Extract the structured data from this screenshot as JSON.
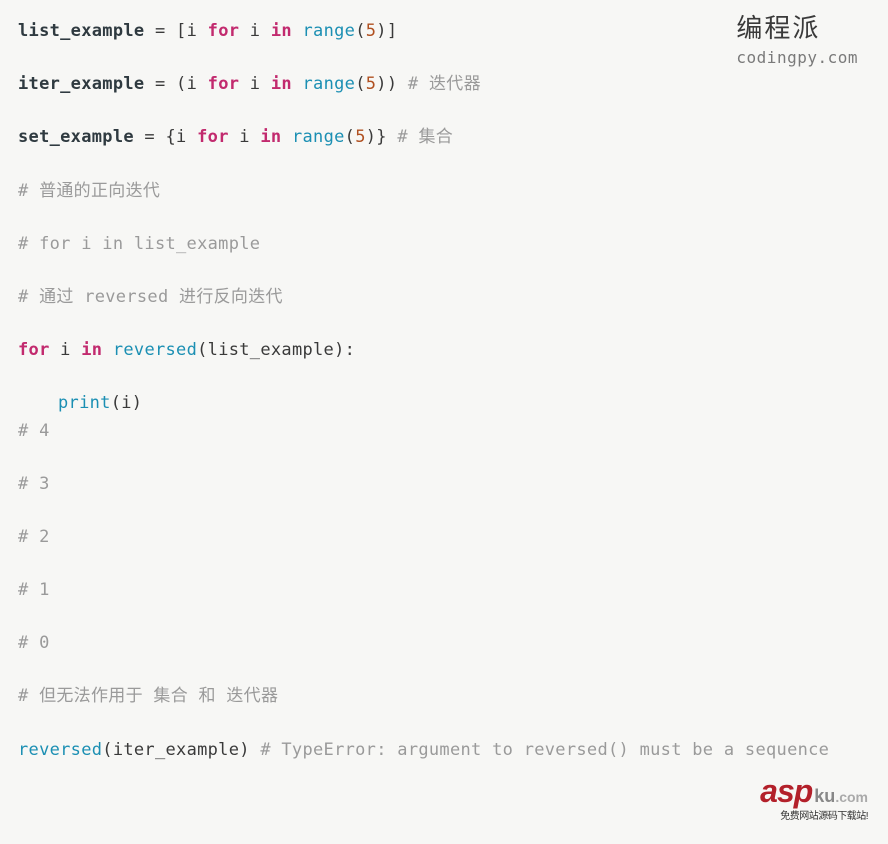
{
  "watermark_top": {
    "brand_cn": "编程派",
    "brand_en": "codingpy.com"
  },
  "watermark_bottom": {
    "asp": "asp",
    "ku": "ku",
    "dom": ".com",
    "sub": "免费网站源码下载站!"
  },
  "code": {
    "l1": {
      "var": "list_example",
      "eq": " = ",
      "lb": "[",
      "i1": "i ",
      "for": "for",
      "i2": " i ",
      "in": "in",
      "sp1": " ",
      "range": "range",
      "lp": "(",
      "num": "5",
      "rp": ")",
      "rb": "]"
    },
    "l2": {
      "var": "iter_example",
      "eq": " = ",
      "lp1": "(",
      "i1": "i ",
      "for": "for",
      "i2": " i ",
      "in": "in",
      "sp1": " ",
      "range": "range",
      "lp2": "(",
      "num": "5",
      "rp2": ")",
      "rp1": ")",
      "cmt": " # 迭代器"
    },
    "l3": {
      "var": "set_example",
      "eq": " = ",
      "lb": "{",
      "i1": "i ",
      "for": "for",
      "i2": " i ",
      "in": "in",
      "sp1": " ",
      "range": "range",
      "lp": "(",
      "num": "5",
      "rp": ")",
      "rb": "}",
      "cmt": " # 集合"
    },
    "l4": {
      "cmt": "# 普通的正向迭代"
    },
    "l5": {
      "cmt": "# for i in list_example"
    },
    "l6": {
      "cmt": "# 通过 reversed 进行反向迭代"
    },
    "l7": {
      "for": "for",
      "sp1": " i ",
      "in": "in",
      "sp2": " ",
      "rev": "reversed",
      "lp": "(",
      "arg": "list_example",
      "rp": ")",
      "colon": ":"
    },
    "l8": {
      "print": "print",
      "lp": "(",
      "arg": "i",
      "rp": ")"
    },
    "l9": {
      "cmt": "# 4"
    },
    "l10": {
      "cmt": "# 3"
    },
    "l11": {
      "cmt": "# 2"
    },
    "l12": {
      "cmt": "# 1"
    },
    "l13": {
      "cmt": "# 0"
    },
    "l14": {
      "cmt": "# 但无法作用于 集合 和 迭代器"
    },
    "l15": {
      "rev": "reversed",
      "lp": "(",
      "arg": "iter_example",
      "rp": ")",
      "cmt": " # TypeError: argument to reversed() must be a sequence"
    }
  }
}
